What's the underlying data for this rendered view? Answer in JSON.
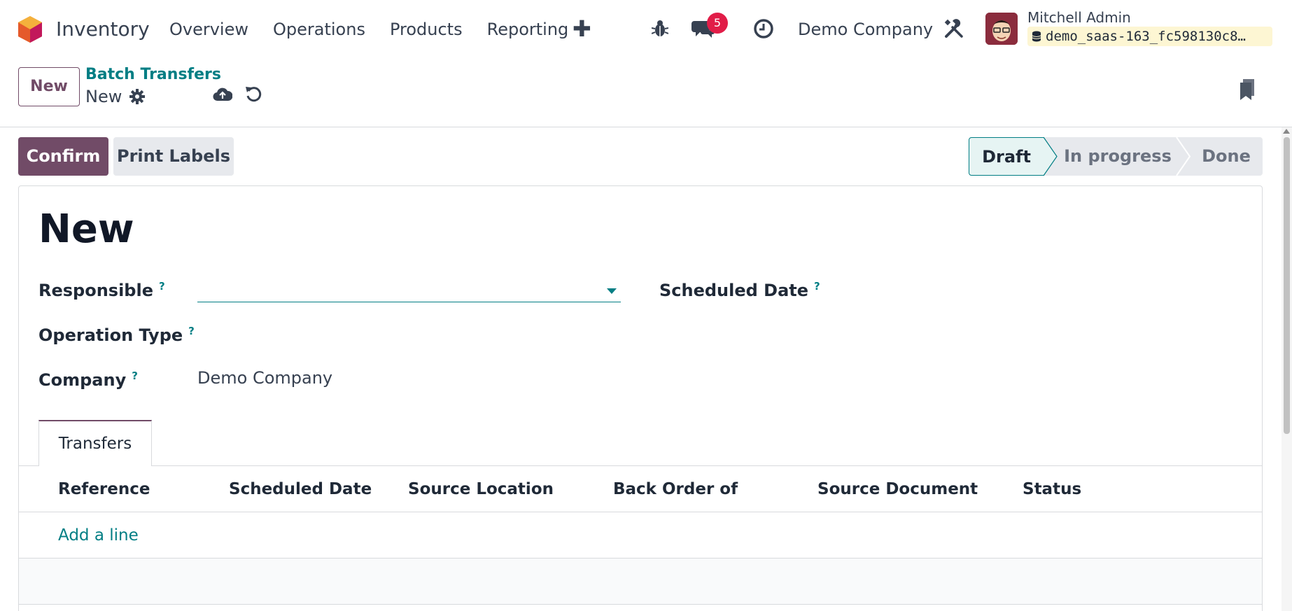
{
  "app": {
    "name": "Inventory"
  },
  "menu": [
    {
      "label": "Overview"
    },
    {
      "label": "Operations"
    },
    {
      "label": "Products"
    },
    {
      "label": "Reporting"
    }
  ],
  "systray": {
    "messages_count": "5",
    "company": "Demo Company",
    "user_name": "Mitchell Admin",
    "database": "demo_saas-163_fc598130c8…"
  },
  "control_panel": {
    "new_button": "New",
    "breadcrumb_parent": "Batch Transfers",
    "record_name": "New"
  },
  "actions": {
    "confirm": "Confirm",
    "print_labels": "Print Labels"
  },
  "stages": {
    "draft": "Draft",
    "in_progress": "In progress",
    "done": "Done",
    "current": "Draft"
  },
  "form": {
    "title": "New",
    "responsible_label": "Responsible",
    "responsible_value": "",
    "scheduled_date_label": "Scheduled Date",
    "operation_type_label": "Operation Type",
    "company_label": "Company",
    "company_value": "Demo Company",
    "help_mark": "?"
  },
  "tabs": [
    {
      "label": "Transfers"
    }
  ],
  "table": {
    "columns": [
      "Reference",
      "Scheduled Date",
      "Source Location",
      "Back Order of",
      "Source Document",
      "Status"
    ],
    "add_line": "Add a line"
  },
  "colors": {
    "brand": "#714b67",
    "accent": "#017e84",
    "badge": "#e11d48"
  },
  "icons": [
    "app-logo-icon",
    "add-icon",
    "bug-icon",
    "chat-icon",
    "clock-icon",
    "tools-icon",
    "database-icon",
    "gear-icon",
    "cloud-upload-icon",
    "discard-icon",
    "bookmark-icon"
  ]
}
